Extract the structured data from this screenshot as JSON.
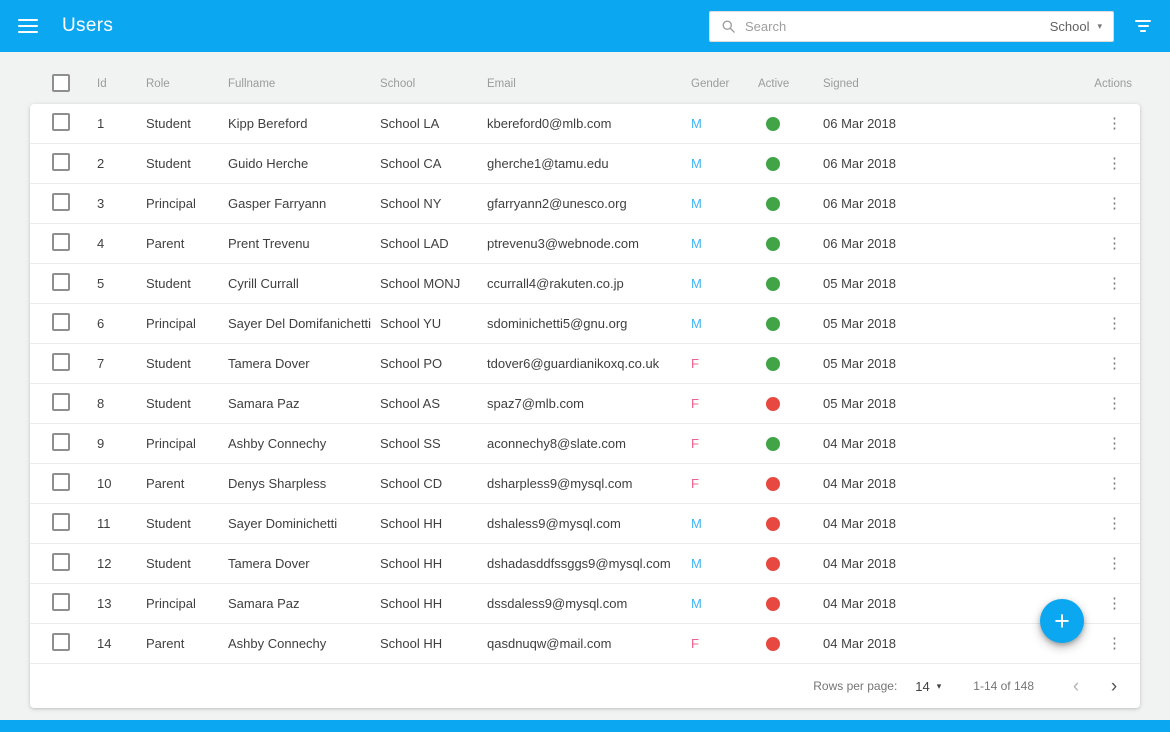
{
  "app_bar": {
    "title": "Users",
    "search": {
      "placeholder": "Search",
      "column_value": "School"
    }
  },
  "table": {
    "columns": [
      "Id",
      "Role",
      "Fullname",
      "School",
      "Email",
      "Gender",
      "Active",
      "Signed",
      "Actions"
    ],
    "rows": [
      {
        "id": "1",
        "role": "Student",
        "fullname": "Kipp Bereford",
        "school": "School LA",
        "email": "kbereford0@mlb.com",
        "gender": "M",
        "active": true,
        "signed": "06 Mar 2018"
      },
      {
        "id": "2",
        "role": "Student",
        "fullname": "Guido Herche",
        "school": "School CA",
        "email": "gherche1@tamu.edu",
        "gender": "M",
        "active": true,
        "signed": "06 Mar 2018"
      },
      {
        "id": "3",
        "role": "Principal",
        "fullname": "Gasper Farryann",
        "school": "School NY",
        "email": "gfarryann2@unesco.org",
        "gender": "M",
        "active": true,
        "signed": "06 Mar 2018"
      },
      {
        "id": "4",
        "role": "Parent",
        "fullname": "Prent Trevenu",
        "school": "School LAD",
        "email": "ptrevenu3@webnode.com",
        "gender": "M",
        "active": true,
        "signed": "06 Mar 2018"
      },
      {
        "id": "5",
        "role": "Student",
        "fullname": "Cyrill Currall",
        "school": "School MONJ",
        "email": "ccurrall4@rakuten.co.jp",
        "gender": "M",
        "active": true,
        "signed": "05 Mar 2018"
      },
      {
        "id": "6",
        "role": "Principal",
        "fullname": "Sayer Del Domifanichetti",
        "school": "School YU",
        "email": "sdominichetti5@gnu.org",
        "gender": "M",
        "active": true,
        "signed": "05 Mar 2018"
      },
      {
        "id": "7",
        "role": "Student",
        "fullname": "Tamera Dover",
        "school": "School PO",
        "email": "tdover6@guardianikoxq.co.uk",
        "gender": "F",
        "active": true,
        "signed": "05 Mar 2018"
      },
      {
        "id": "8",
        "role": "Student",
        "fullname": "Samara Paz",
        "school": "School AS",
        "email": "spaz7@mlb.com",
        "gender": "F",
        "active": false,
        "signed": "05 Mar 2018"
      },
      {
        "id": "9",
        "role": "Principal",
        "fullname": "Ashby Connechy",
        "school": "School SS",
        "email": "aconnechy8@slate.com",
        "gender": "F",
        "active": true,
        "signed": "04 Mar 2018"
      },
      {
        "id": "10",
        "role": "Parent",
        "fullname": "Denys Sharpless",
        "school": "School CD",
        "email": "dsharpless9@mysql.com",
        "gender": "F",
        "active": false,
        "signed": "04 Mar 2018"
      },
      {
        "id": "11",
        "role": "Student",
        "fullname": "Sayer Dominichetti",
        "school": "School HH",
        "email": "dshaless9@mysql.com",
        "gender": "M",
        "active": false,
        "signed": "04 Mar 2018"
      },
      {
        "id": "12",
        "role": "Student",
        "fullname": "Tamera Dover",
        "school": "School HH",
        "email": "dshadasddfssggs9@mysql.com",
        "gender": "M",
        "active": false,
        "signed": "04 Mar 2018"
      },
      {
        "id": "13",
        "role": "Principal",
        "fullname": "Samara Paz",
        "school": "School HH",
        "email": "dssdaless9@mysql.com",
        "gender": "M",
        "active": false,
        "signed": "04 Mar 2018"
      },
      {
        "id": "14",
        "role": "Parent",
        "fullname": "Ashby Connechy",
        "school": "School HH",
        "email": "qasdnuqw@mail.com",
        "gender": "F",
        "active": false,
        "signed": "04 Mar 2018"
      }
    ]
  },
  "footer": {
    "rows_per_page_label": "Rows per page:",
    "rows_per_page_value": "14",
    "range_label": "1-14 of 148"
  },
  "icons": {
    "kebab": "⋮",
    "caret_down": "▾",
    "chevron_left": "‹",
    "chevron_right": "›",
    "plus": "+"
  },
  "colors": {
    "accent": "#0ba7f0",
    "gender_m": "#42b3f4",
    "gender_f": "#f0628b",
    "active_green": "#41a447",
    "active_red": "#e7483f",
    "header_text": "#9b9b9b",
    "row_text": "#3f3f3f"
  }
}
